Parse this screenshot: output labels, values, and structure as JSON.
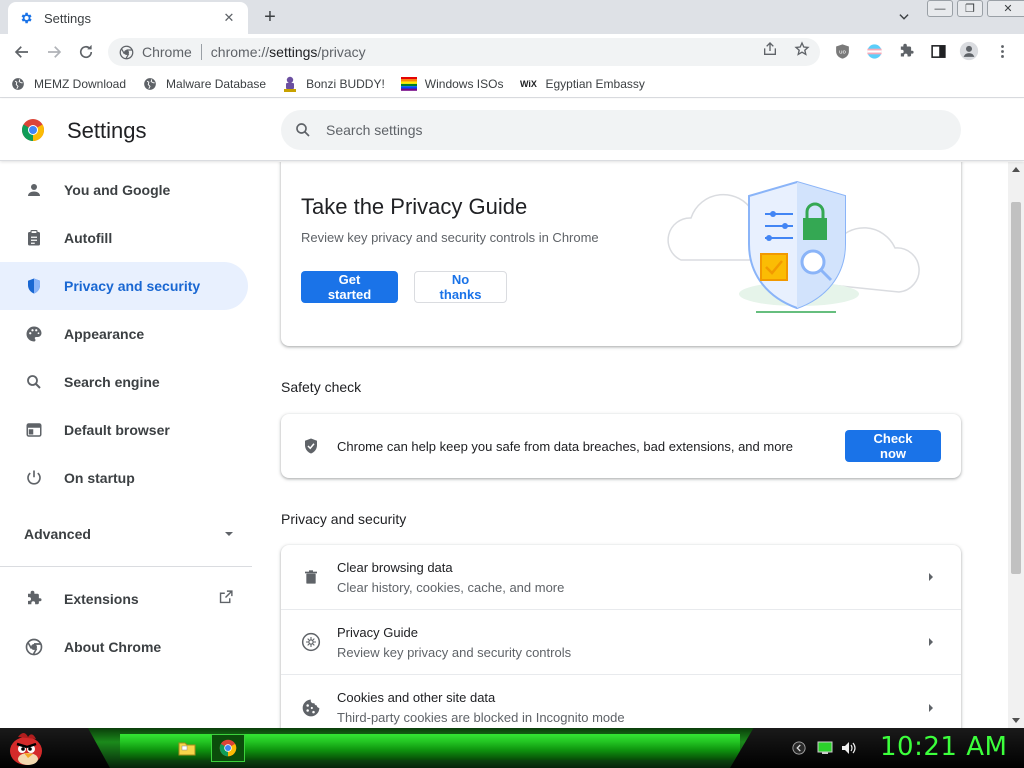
{
  "tab": {
    "title": "Settings",
    "close_label": "✕",
    "new_tab_label": "+"
  },
  "window": {
    "minimize": "—",
    "restore": "❐",
    "close": "✕"
  },
  "omnibox": {
    "site": "Chrome",
    "url_prefix": "chrome://",
    "url_host": "settings",
    "url_path": "/privacy"
  },
  "bookmarks": [
    {
      "label": "MEMZ Download",
      "icon": "globe-icon"
    },
    {
      "label": "Malware Database",
      "icon": "globe-icon"
    },
    {
      "label": "Bonzi BUDDY!",
      "icon": "bonzi-icon"
    },
    {
      "label": "Windows ISOs",
      "icon": "windows-icon"
    },
    {
      "label": "Egyptian Embassy",
      "icon": "wix-icon"
    }
  ],
  "wix_text": "WiX",
  "header": {
    "title": "Settings",
    "search_placeholder": "Search settings"
  },
  "sidebar": {
    "items": [
      {
        "label": "You and Google",
        "icon": "person-icon"
      },
      {
        "label": "Autofill",
        "icon": "clipboard-icon"
      },
      {
        "label": "Privacy and security",
        "icon": "shield-icon",
        "active": true
      },
      {
        "label": "Appearance",
        "icon": "palette-icon"
      },
      {
        "label": "Search engine",
        "icon": "search-icon"
      },
      {
        "label": "Default browser",
        "icon": "browser-icon"
      },
      {
        "label": "On startup",
        "icon": "power-icon"
      }
    ],
    "advanced": "Advanced",
    "extensions": "Extensions",
    "about": "About Chrome"
  },
  "privacy_guide": {
    "title": "Take the Privacy Guide",
    "description": "Review key privacy and security controls in Chrome",
    "primary": "Get started",
    "secondary": "No thanks"
  },
  "safety_check": {
    "heading": "Safety check",
    "text": "Chrome can help keep you safe from data breaches, bad extensions, and more",
    "button": "Check now"
  },
  "privacy_section": {
    "heading": "Privacy and security",
    "rows": [
      {
        "title": "Clear browsing data",
        "subtitle": "Clear history, cookies, cache, and more",
        "icon": "trash-icon"
      },
      {
        "title": "Privacy Guide",
        "subtitle": "Review key privacy and security controls",
        "icon": "compass-icon"
      },
      {
        "title": "Cookies and other site data",
        "subtitle": "Third-party cookies are blocked in Incognito mode",
        "icon": "cookie-icon"
      }
    ]
  },
  "taskbar": {
    "clock": "10:21 AM"
  },
  "colors": {
    "accent": "#1a73e8",
    "active_nav_bg": "#e8f0fe",
    "clock": "#3cff3c"
  }
}
